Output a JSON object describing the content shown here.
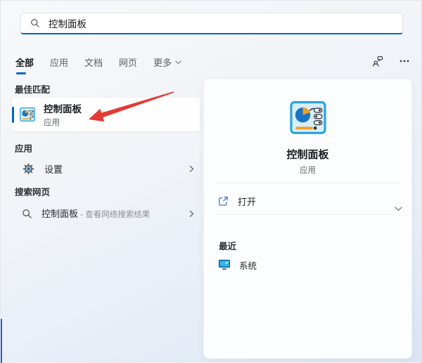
{
  "search": {
    "value": "控制面板",
    "icon": "search-icon"
  },
  "tabs": {
    "items": [
      {
        "label": "全部",
        "active": true
      },
      {
        "label": "应用",
        "active": false
      },
      {
        "label": "文档",
        "active": false
      },
      {
        "label": "网页",
        "active": false
      },
      {
        "label": "更多",
        "active": false,
        "has_dropdown": true
      }
    ]
  },
  "header_actions": {
    "account_icon": "user-account-icon",
    "more_icon": "ellipsis-icon"
  },
  "left": {
    "best_match_header": "最佳匹配",
    "best_match": {
      "title": "控制面板",
      "subtitle": "应用",
      "icon": "control-panel-icon"
    },
    "apps_header": "应用",
    "apps": [
      {
        "label": "设置",
        "icon": "gear-icon"
      }
    ],
    "web_header": "搜索网页",
    "web": [
      {
        "query": "控制面板",
        "suffix": " - 查看网络搜索结果",
        "icon": "search-icon"
      }
    ]
  },
  "right": {
    "icon": "control-panel-icon",
    "title": "控制面板",
    "subtitle": "应用",
    "open_label": "打开",
    "open_icon": "open-external-icon",
    "recent_header": "最近",
    "recent": [
      {
        "label": "系统",
        "icon": "system-monitor-icon"
      }
    ]
  },
  "annotation": {
    "shape": "red-arrow",
    "color": "#e53935"
  },
  "colors": {
    "accent": "#0067c0",
    "arrow_red": "#e53935",
    "card_bg": "#fcfdfe"
  }
}
